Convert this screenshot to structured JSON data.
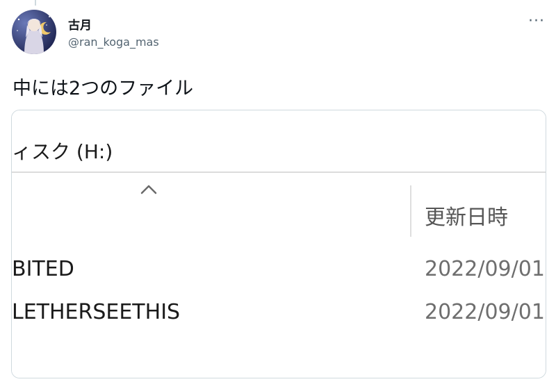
{
  "tweet": {
    "display_name": "古月",
    "handle": "@ran_koga_mas",
    "more_label": "···",
    "text": "中には2つのファイル"
  },
  "explorer": {
    "title": "ィスク (H:)",
    "sort_icon": "chevron-up-icon",
    "column_date_header": "更新日時",
    "files": [
      {
        "name": "BITED",
        "date": "2022/09/01"
      },
      {
        "name": "LETHERSEETHIS",
        "date": "2022/09/01"
      }
    ]
  },
  "colors": {
    "text_primary": "#0f1419",
    "text_secondary": "#536471",
    "card_border": "#cfd9de"
  }
}
